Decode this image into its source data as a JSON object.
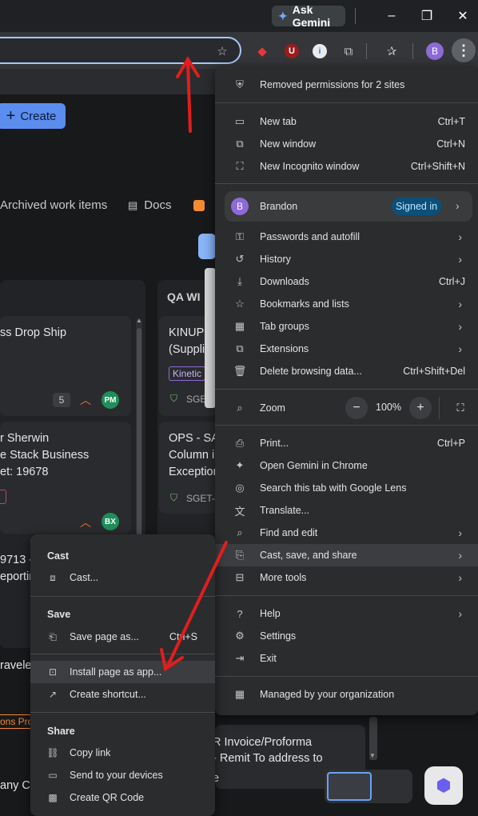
{
  "browser": {
    "ask_gemini": "Ask Gemini",
    "profile_initial": "B"
  },
  "page": {
    "create_label": "Create",
    "tabs": [
      "Archived work items",
      "Docs"
    ],
    "column_header": "QA WI",
    "cards_left": [
      {
        "text": "ss Drop Ship",
        "count": "5",
        "avatar": "PM"
      },
      {
        "text": "r Sherwin\ne Stack Business\net: 19678",
        "avatar": "BX"
      },
      {
        "text": "9713 -\neportin"
      },
      {
        "text": "ravele"
      }
    ],
    "cards_right": [
      {
        "text": "KINUP\n(Suppli",
        "tag": "Kinetic",
        "ref": "SGET-"
      },
      {
        "text": "OPS - SA\nColumn i\nException",
        "ref": "SGET-"
      }
    ],
    "bottom_fragments": [
      "ons Pro",
      "any Co",
      "R Invoice/Proforma",
      "- Remit To address to",
      "e"
    ]
  },
  "menu": {
    "notice": "Removed permissions for 2 sites",
    "items_group1": [
      {
        "label": "New tab",
        "shortcut": "Ctrl+T",
        "icon": "new-tab-icon"
      },
      {
        "label": "New window",
        "shortcut": "Ctrl+N",
        "icon": "new-window-icon"
      },
      {
        "label": "New Incognito window",
        "shortcut": "Ctrl+Shift+N",
        "icon": "incognito-icon"
      }
    ],
    "profile": {
      "initial": "B",
      "name": "Brandon",
      "status": "Signed in"
    },
    "items_group2": [
      {
        "label": "Passwords and autofill",
        "icon": "key-icon"
      },
      {
        "label": "History",
        "icon": "history-icon"
      },
      {
        "label": "Downloads",
        "shortcut": "Ctrl+J",
        "icon": "download-icon"
      },
      {
        "label": "Bookmarks and lists",
        "icon": "star-icon"
      },
      {
        "label": "Tab groups",
        "icon": "tab-groups-icon"
      },
      {
        "label": "Extensions",
        "icon": "puzzle-icon"
      },
      {
        "label": "Delete browsing data...",
        "shortcut": "Ctrl+Shift+Del",
        "icon": "trash-icon"
      }
    ],
    "zoom": {
      "label": "Zoom",
      "value": "100%"
    },
    "items_group3": [
      {
        "label": "Print...",
        "shortcut": "Ctrl+P",
        "icon": "print-icon"
      },
      {
        "label": "Open Gemini in Chrome",
        "icon": "gemini-icon"
      },
      {
        "label": "Search this tab with Google Lens",
        "icon": "lens-icon"
      },
      {
        "label": "Translate...",
        "icon": "translate-icon"
      },
      {
        "label": "Find and edit",
        "icon": "find-icon"
      },
      {
        "label": "Cast, save, and share",
        "icon": "cast-save-icon"
      },
      {
        "label": "More tools",
        "icon": "toolbox-icon"
      }
    ],
    "items_group4": [
      {
        "label": "Help",
        "icon": "help-icon"
      },
      {
        "label": "Settings",
        "icon": "settings-icon"
      },
      {
        "label": "Exit",
        "icon": "exit-icon"
      }
    ],
    "managed": "Managed by your organization"
  },
  "submenu": {
    "cast_header": "Cast",
    "cast": "Cast...",
    "save_header": "Save",
    "save_page": "Save page as...",
    "save_page_shortcut": "Ctrl+S",
    "install_app": "Install page as app...",
    "create_shortcut": "Create shortcut...",
    "share_header": "Share",
    "copy_link": "Copy link",
    "send_devices": "Send to your devices",
    "qr_code": "Create QR Code"
  },
  "annotation_color": "#e01e1e"
}
